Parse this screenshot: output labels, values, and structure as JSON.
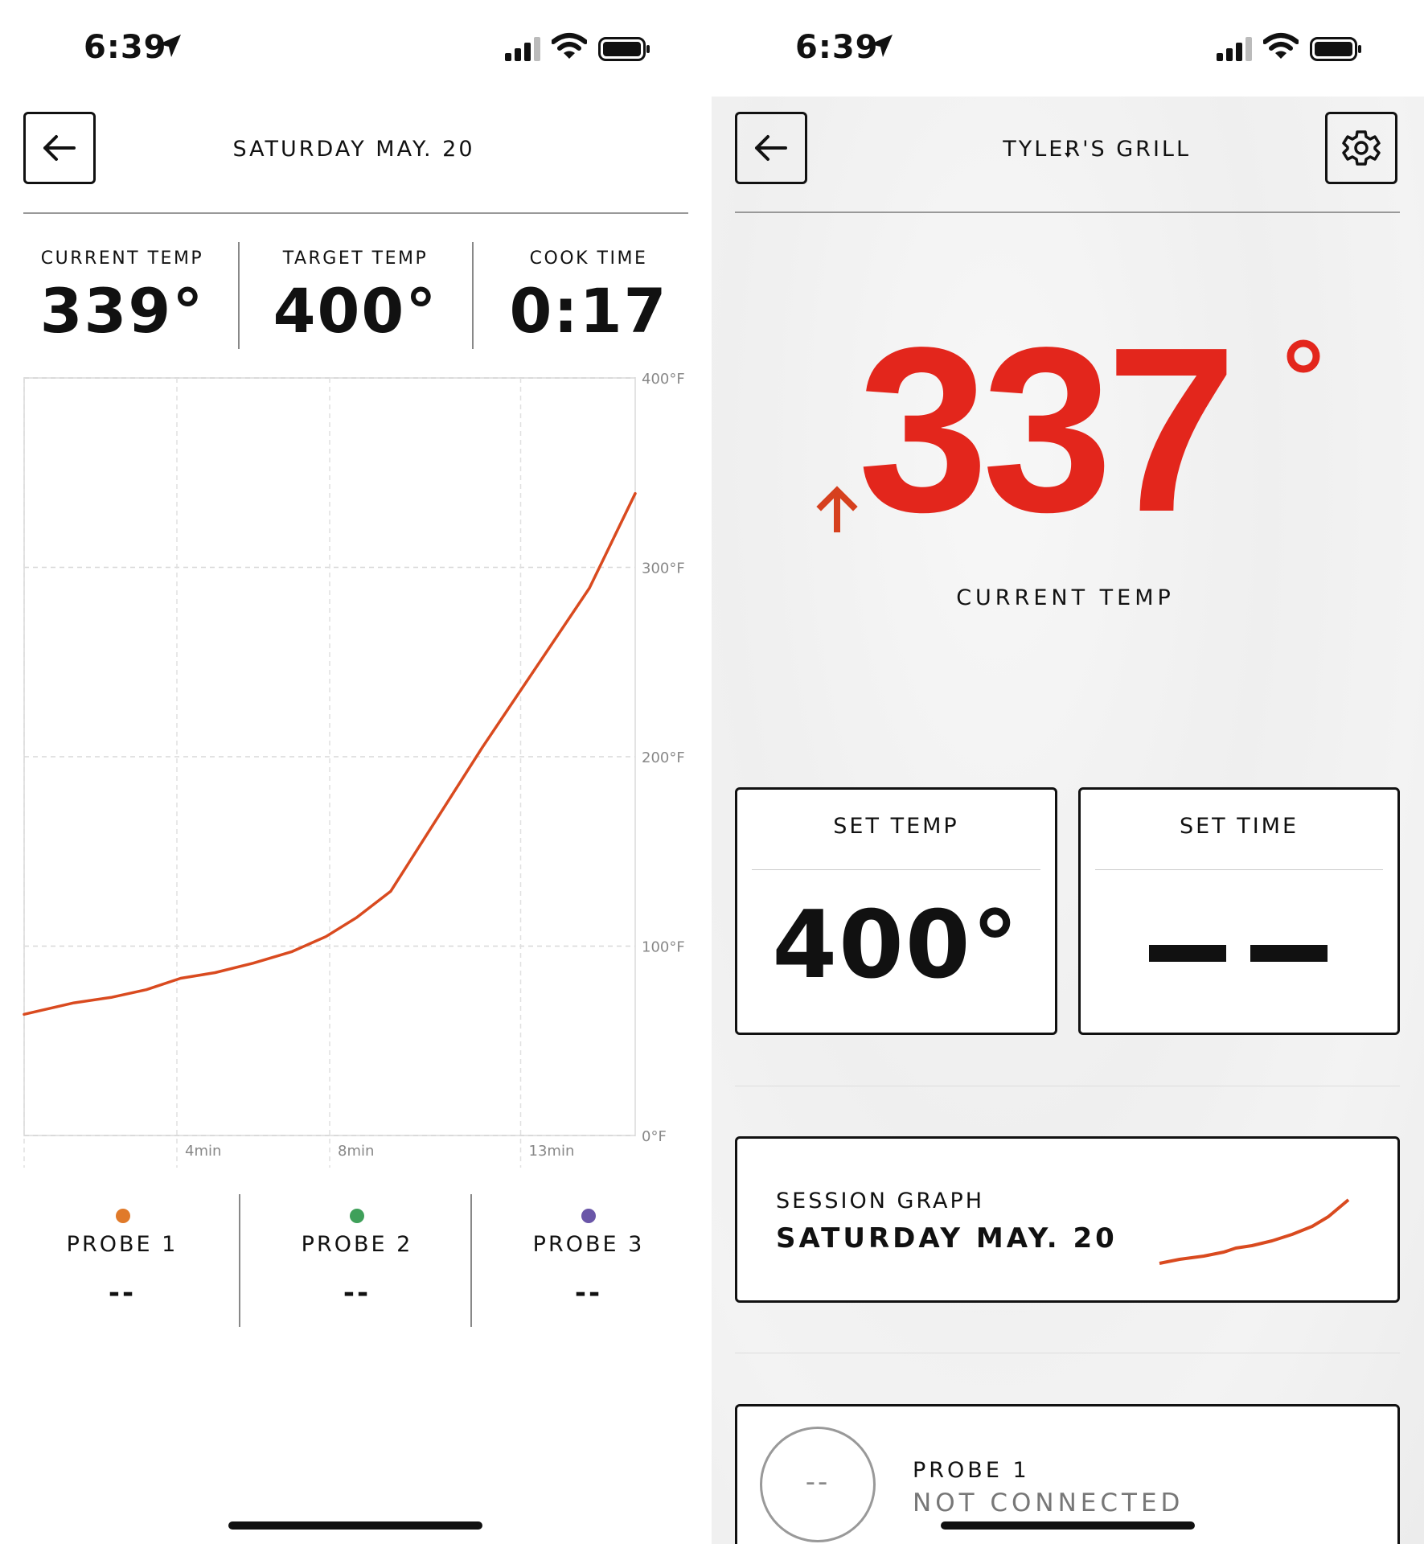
{
  "left": {
    "status_time": "6:39",
    "header_title": "SATURDAY MAY. 20",
    "stats": [
      {
        "label": "CURRENT TEMP",
        "value": "339°"
      },
      {
        "label": "TARGET TEMP",
        "value": "400°"
      },
      {
        "label": "COOK TIME",
        "value": "0:17"
      }
    ],
    "probes": [
      {
        "label": "PROBE 1",
        "value": "--",
        "color": "#e07a2a"
      },
      {
        "label": "PROBE 2",
        "value": "--",
        "color": "#3fa05a"
      },
      {
        "label": "PROBE 3",
        "value": "--",
        "color": "#6a56a8"
      }
    ]
  },
  "chart_data": {
    "type": "line",
    "x_unit": "min",
    "x_ticks": [
      {
        "value": 4,
        "label": "4min"
      },
      {
        "value": 8,
        "label": "8min"
      },
      {
        "value": 13,
        "label": "13min"
      }
    ],
    "y_ticks": [
      {
        "value": 400,
        "label": "400°F"
      },
      {
        "value": 300,
        "label": "300°F"
      },
      {
        "value": 200,
        "label": "200°F"
      },
      {
        "value": 100,
        "label": "100°F"
      },
      {
        "value": 0,
        "label": "0°F"
      }
    ],
    "xlim": [
      0,
      16
    ],
    "ylim": [
      0,
      400
    ],
    "grid": true,
    "line_color": "#d94a1f",
    "series": [
      {
        "x": [
          0,
          1.3,
          2.3,
          3.2,
          4.1,
          5.0,
          6.0,
          7.0,
          7.9,
          8.7,
          9.6,
          12.0,
          14.8,
          16.0
        ],
        "y": [
          64,
          70,
          73,
          77,
          83,
          86,
          91,
          97,
          105,
          115,
          129,
          205,
          289,
          339
        ]
      }
    ]
  },
  "right": {
    "status_time": "6:39",
    "grill_name": "TYLER'S GRILL",
    "current_temp": "337",
    "degree": "°",
    "current_temp_label": "CURRENT TEMP",
    "accent_color": "#e3261c",
    "set_temp_label": "SET TEMP",
    "set_temp_value": "400°",
    "set_time_label": "SET TIME",
    "session_label": "SESSION GRAPH",
    "session_date": "SATURDAY MAY. 20",
    "probe_circle_text": "--",
    "probe_name": "PROBE 1",
    "probe_status": "NOT CONNECTED"
  }
}
